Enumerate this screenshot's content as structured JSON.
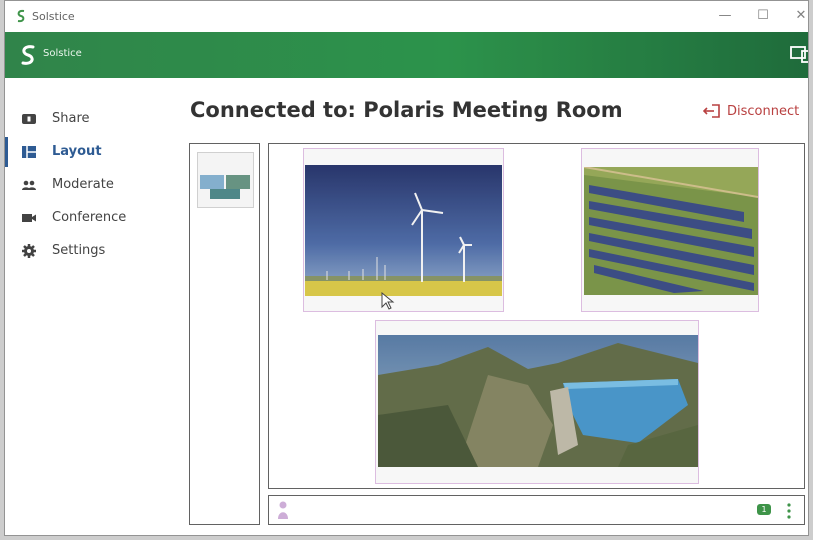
{
  "window": {
    "title": "Solstice",
    "controls": {
      "minimize": "—",
      "maximize": "☐",
      "close": "✕"
    }
  },
  "header": {
    "brand": "Solstice"
  },
  "sidebar": {
    "items": [
      {
        "label": "Share",
        "icon": "share-icon"
      },
      {
        "label": "Layout",
        "icon": "layout-icon",
        "active": true
      },
      {
        "label": "Moderate",
        "icon": "people-icon"
      },
      {
        "label": "Conference",
        "icon": "camera-icon"
      },
      {
        "label": "Settings",
        "icon": "gear-icon"
      }
    ]
  },
  "main": {
    "title": "Connected to: Polaris Meeting Room",
    "disconnect_label": "Disconnect"
  },
  "bottom_bar": {
    "participant_count": "1"
  },
  "colors": {
    "brand_green": "#1b8a3c",
    "active_blue": "#1d4e8a",
    "disconnect_red": "#b33030",
    "post_border": "#d9b8de"
  }
}
